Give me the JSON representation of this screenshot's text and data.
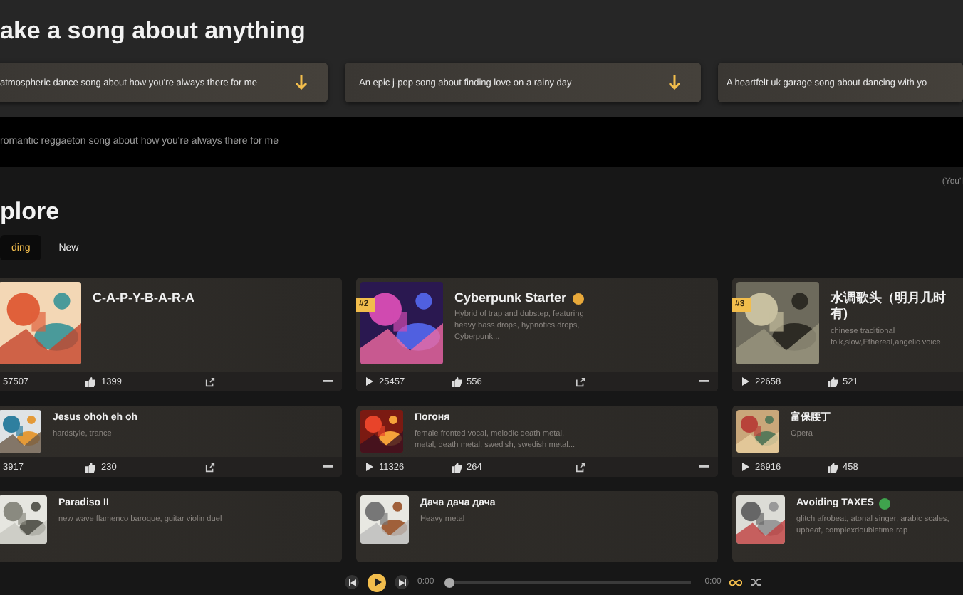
{
  "create": {
    "title": "ake a song about anything",
    "suggestions": [
      "atmospheric dance song about how you're always there for me",
      "An epic j-pop song about finding love on a rainy day",
      "A heartfelt uk garage song about dancing with yo"
    ],
    "prompt_placeholder": "romantic reggaeton song about how you're always there for me",
    "note": "(You'l"
  },
  "explore": {
    "title": "plore",
    "tabs": [
      {
        "label": "ding",
        "selected": true
      },
      {
        "label": "New",
        "selected": false
      }
    ],
    "rows": [
      {
        "kind": "large",
        "cards": [
          {
            "title": "C-A-P-Y-B-A-R-A",
            "plays": "57507",
            "play_icon": false,
            "likes": "1399",
            "actions": true
          },
          {
            "title": "Cyberpunk Starter",
            "color": "#e8a93a",
            "rank": "#2",
            "description": "Hybrid of trap and dubstep, featuring heavy bass drops, hypnotics drops, Cyberpunk...",
            "plays": "25457",
            "play_icon": true,
            "likes": "556",
            "actions": true
          },
          {
            "title": "水调歌头（明月几时有)",
            "rank": "#3",
            "description": "chinese traditional folk,slow,Ethereal,angelic voice",
            "plays": "22658",
            "play_icon": true,
            "likes": "521"
          }
        ]
      },
      {
        "kind": "small",
        "cards": [
          {
            "title": "Jesus ohoh eh oh",
            "description": "hardstyle, trance",
            "plays": "3917",
            "play_icon": false,
            "likes": "230",
            "actions": true
          },
          {
            "title": "Погоня",
            "description": "female fronted vocal, melodic death metal, metal, death metal, swedish, swedish metal...",
            "plays": "11326",
            "play_icon": true,
            "likes": "264",
            "actions": true
          },
          {
            "title": "富保腰丁",
            "description": "Opera",
            "plays": "26916",
            "play_icon": true,
            "likes": "458"
          }
        ]
      },
      {
        "kind": "small",
        "cards": [
          {
            "title": "Paradiso II",
            "description": "new wave flamenco baroque, guitar violin duel"
          },
          {
            "title": "Дача дача дача",
            "description": "Heavy metal"
          },
          {
            "title": "Avoiding TAXES",
            "color": "#3fa34d",
            "description": "glitch afrobeat, atonal singer, arabic scales, upbeat, complexdoubletime rap"
          }
        ]
      }
    ]
  },
  "player": {
    "playing": false,
    "elapsed": "0:00",
    "duration": "0:00",
    "level": 0,
    "loop": true
  }
}
